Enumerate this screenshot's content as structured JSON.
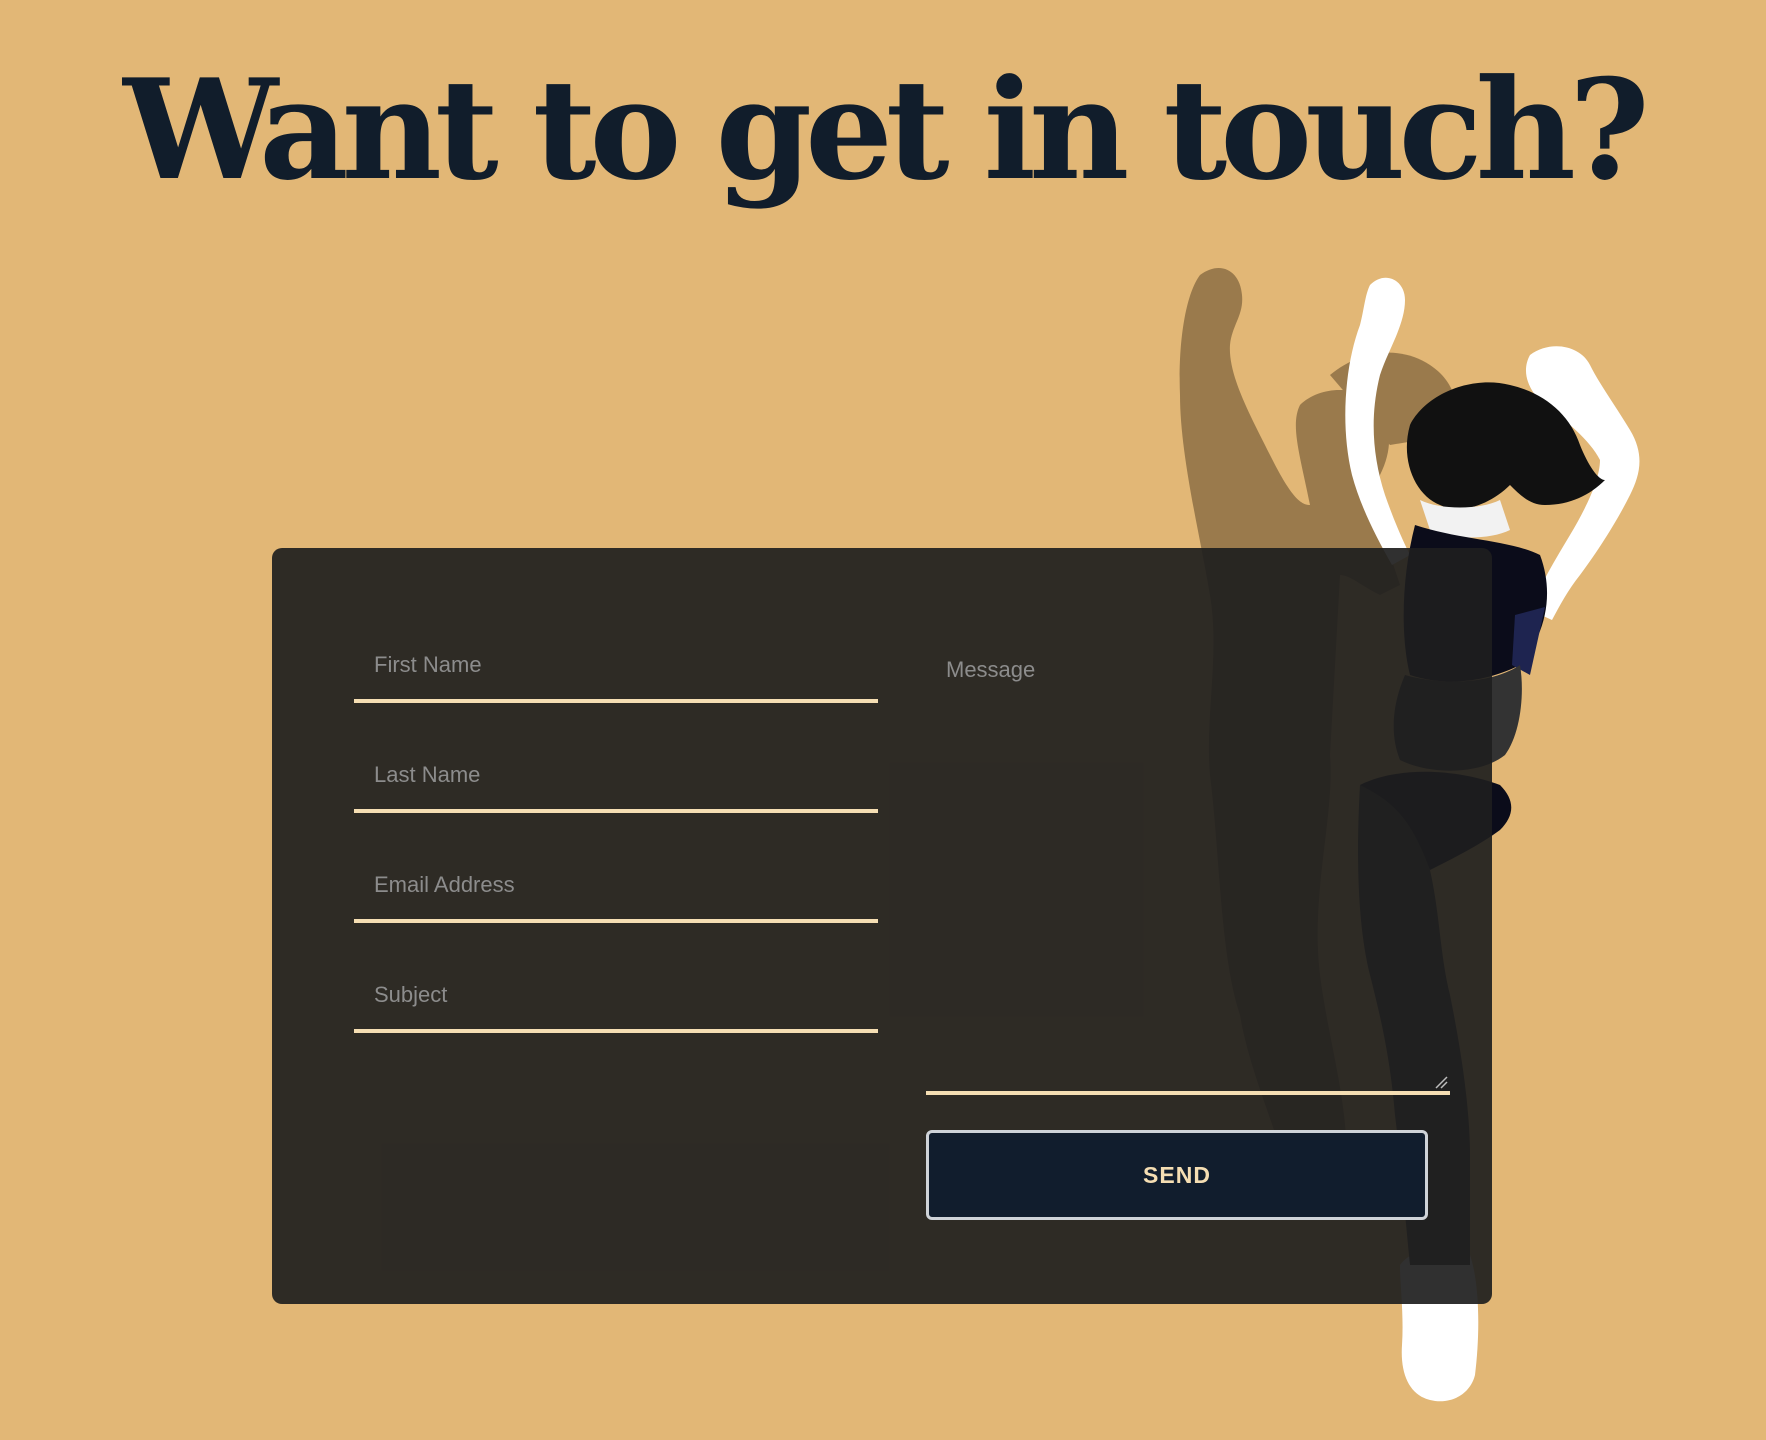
{
  "page": {
    "headline": "Want to get in touch?"
  },
  "form": {
    "first_name_placeholder": "First Name",
    "last_name_placeholder": "Last Name",
    "email_placeholder": "Email Address",
    "subject_placeholder": "Subject",
    "message_placeholder": "Message",
    "send_label": "SEND"
  },
  "colors": {
    "background": "#e2b776",
    "headline": "#111d2b",
    "card": "#1e1e1e",
    "field_underline": "#f5deb3",
    "button_bg": "#111d2d",
    "button_text": "#f5deb3"
  },
  "illustration": {
    "icon": "dancer-figure-illustration"
  }
}
